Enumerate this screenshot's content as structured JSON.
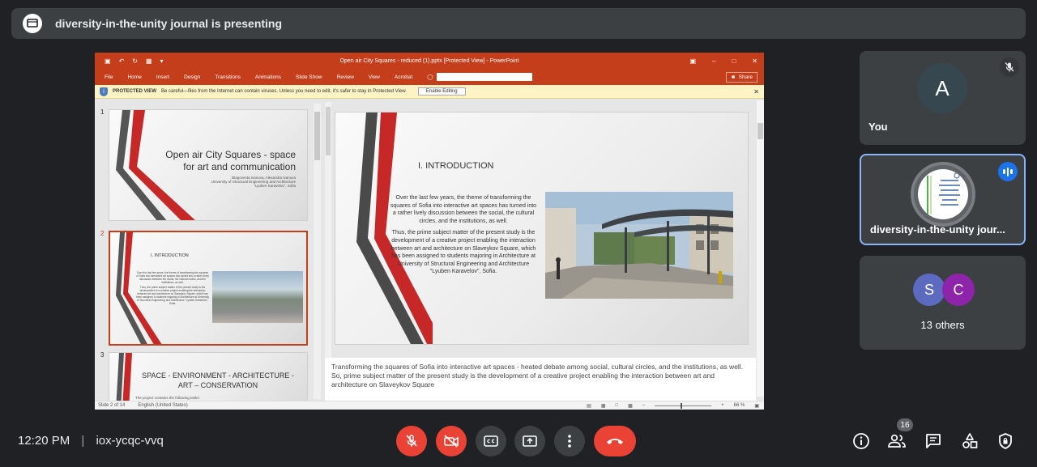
{
  "banner": {
    "title": "diversity-in-the-unity journal is presenting"
  },
  "powerpoint": {
    "title": "Open air City Squares - reduced (1).pptx [Protected View] - PowerPoint",
    "tabs": [
      "File",
      "Home",
      "Insert",
      "Design",
      "Transitions",
      "Animations",
      "Slide Show",
      "Review",
      "View",
      "Acrobat"
    ],
    "share_label": "Share",
    "protected": {
      "label": "PROTECTED VIEW",
      "message": "Be careful—files from the Internet can contain viruses. Unless you need to edit, it's safer to stay in Protected View.",
      "button": "Enable Editing"
    },
    "thumbnails": [
      {
        "number": "1",
        "title_line1": "Open air City Squares - space",
        "title_line2": "for art and communication",
        "authors": "Blagovesta Ivanova, Alexandra Ivanova",
        "affil1": "University of Structural Engineering and Architecture",
        "affil2": "\"Lyuben Karavelov\", Sofia"
      },
      {
        "number": "2",
        "heading": "I.   INTRODUCTION",
        "p1": "Over the last few years, the theme of transforming the squares of Sofia into interactive art spaces has turned into a rather lively discussion between the social, the cultural circles, and the institutions, as well.",
        "p2": "Thus, the prime subject matter of the present study is the development of a creative project enabling the interaction between art and architecture on Slaveykov Square, which has been assigned to students majoring in Architecture at University of Structural Engineering and Architecture \"Lyuben Karavelov\", Sofia."
      },
      {
        "number": "3",
        "title_line1": "SPACE - ENVIRONMENT - ARCHITECTURE -",
        "title_line2": "ART – CONSERVATION",
        "body": "The project contains the following tasks:"
      }
    ],
    "main_slide": {
      "heading": "I.    INTRODUCTION",
      "p1": "Over the last few years, the theme of transforming the squares of Sofia into interactive art spaces has turned into a rather lively discussion between the social, the cultural circles, and the institutions, as well.",
      "p2": "Thus, the prime subject matter of the present study is the development of a creative project enabling the interaction between art and architecture on Slaveykov Square, which has been assigned to students majoring in Architecture at University of Structural Engineering and Architecture \"Lyuben Karavelov\", Sofia."
    },
    "notes": "Transforming the squares of Sofia into interactive art spaces - heated debate among social, cultural circles, and the institutions, as well. So, prime subject matter of the present study is the development of a creative project enabling the interaction between art and architecture on Slaveykov Square",
    "status": {
      "slide": "Slide 2 of 14",
      "language": "English (United States)",
      "zoom": "66 %"
    }
  },
  "participants": {
    "you": {
      "initial": "A",
      "name": "You",
      "avatar_color": "#37474f"
    },
    "presenter": {
      "name": "diversity-in-the-unity jour..."
    },
    "others": {
      "initials": [
        "S",
        "C"
      ],
      "colors": [
        "#5c6bc0",
        "#8e24aa"
      ],
      "label": "13 others"
    }
  },
  "bottom_bar": {
    "time": "12:20 PM",
    "meeting_code": "iox-ycqc-vvq",
    "people_count": "16"
  },
  "colors": {
    "danger": "#ea4335",
    "accent": "#1a73e8",
    "ppt": "#c43e1c"
  }
}
